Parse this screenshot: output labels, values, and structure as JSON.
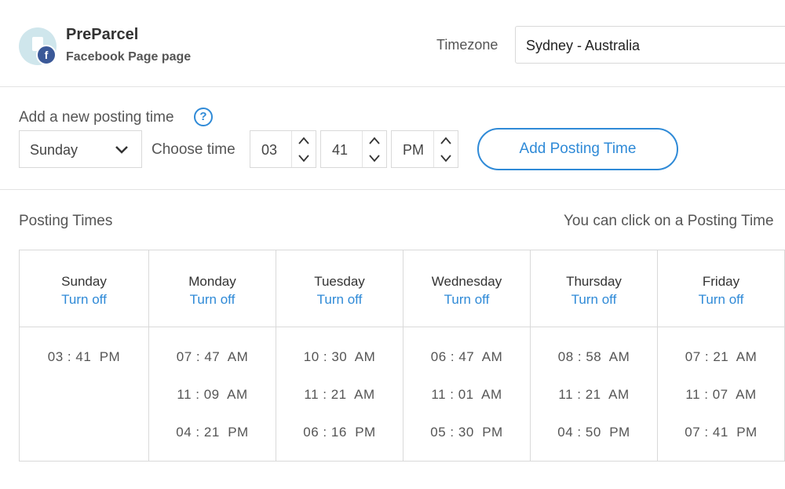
{
  "account": {
    "name": "PreParcel",
    "type": "Facebook Page page",
    "icon": "facebook-icon"
  },
  "timezone": {
    "label": "Timezone",
    "value": "Sydney - Australia"
  },
  "add_posting": {
    "label": "Add a new posting time",
    "help_icon": "?",
    "day_value": "Sunday",
    "choose_time_label": "Choose time",
    "hour": "03",
    "minute": "41",
    "ampm": "PM",
    "add_button": "Add Posting Time"
  },
  "posting_times": {
    "label": "Posting Times",
    "hint": "You can click on a Posting Time",
    "turn_off_label": "Turn off",
    "days": [
      {
        "name": "Sunday",
        "times": [
          "03 : 41  PM"
        ]
      },
      {
        "name": "Monday",
        "times": [
          "07 : 47  AM",
          "11 : 09  AM",
          "04 : 21  PM"
        ]
      },
      {
        "name": "Tuesday",
        "times": [
          "10 : 30  AM",
          "11 : 21  AM",
          "06 : 16  PM"
        ]
      },
      {
        "name": "Wednesday",
        "times": [
          "06 : 47  AM",
          "11 : 01  AM",
          "05 : 30  PM"
        ]
      },
      {
        "name": "Thursday",
        "times": [
          "08 : 58  AM",
          "11 : 21  AM",
          "04 : 50  PM"
        ]
      },
      {
        "name": "Friday",
        "times": [
          "07 : 21  AM",
          "11 : 07  AM",
          "07 : 41  PM"
        ]
      }
    ]
  },
  "colors": {
    "accent": "#2f8ad7",
    "facebook": "#3b5998"
  }
}
